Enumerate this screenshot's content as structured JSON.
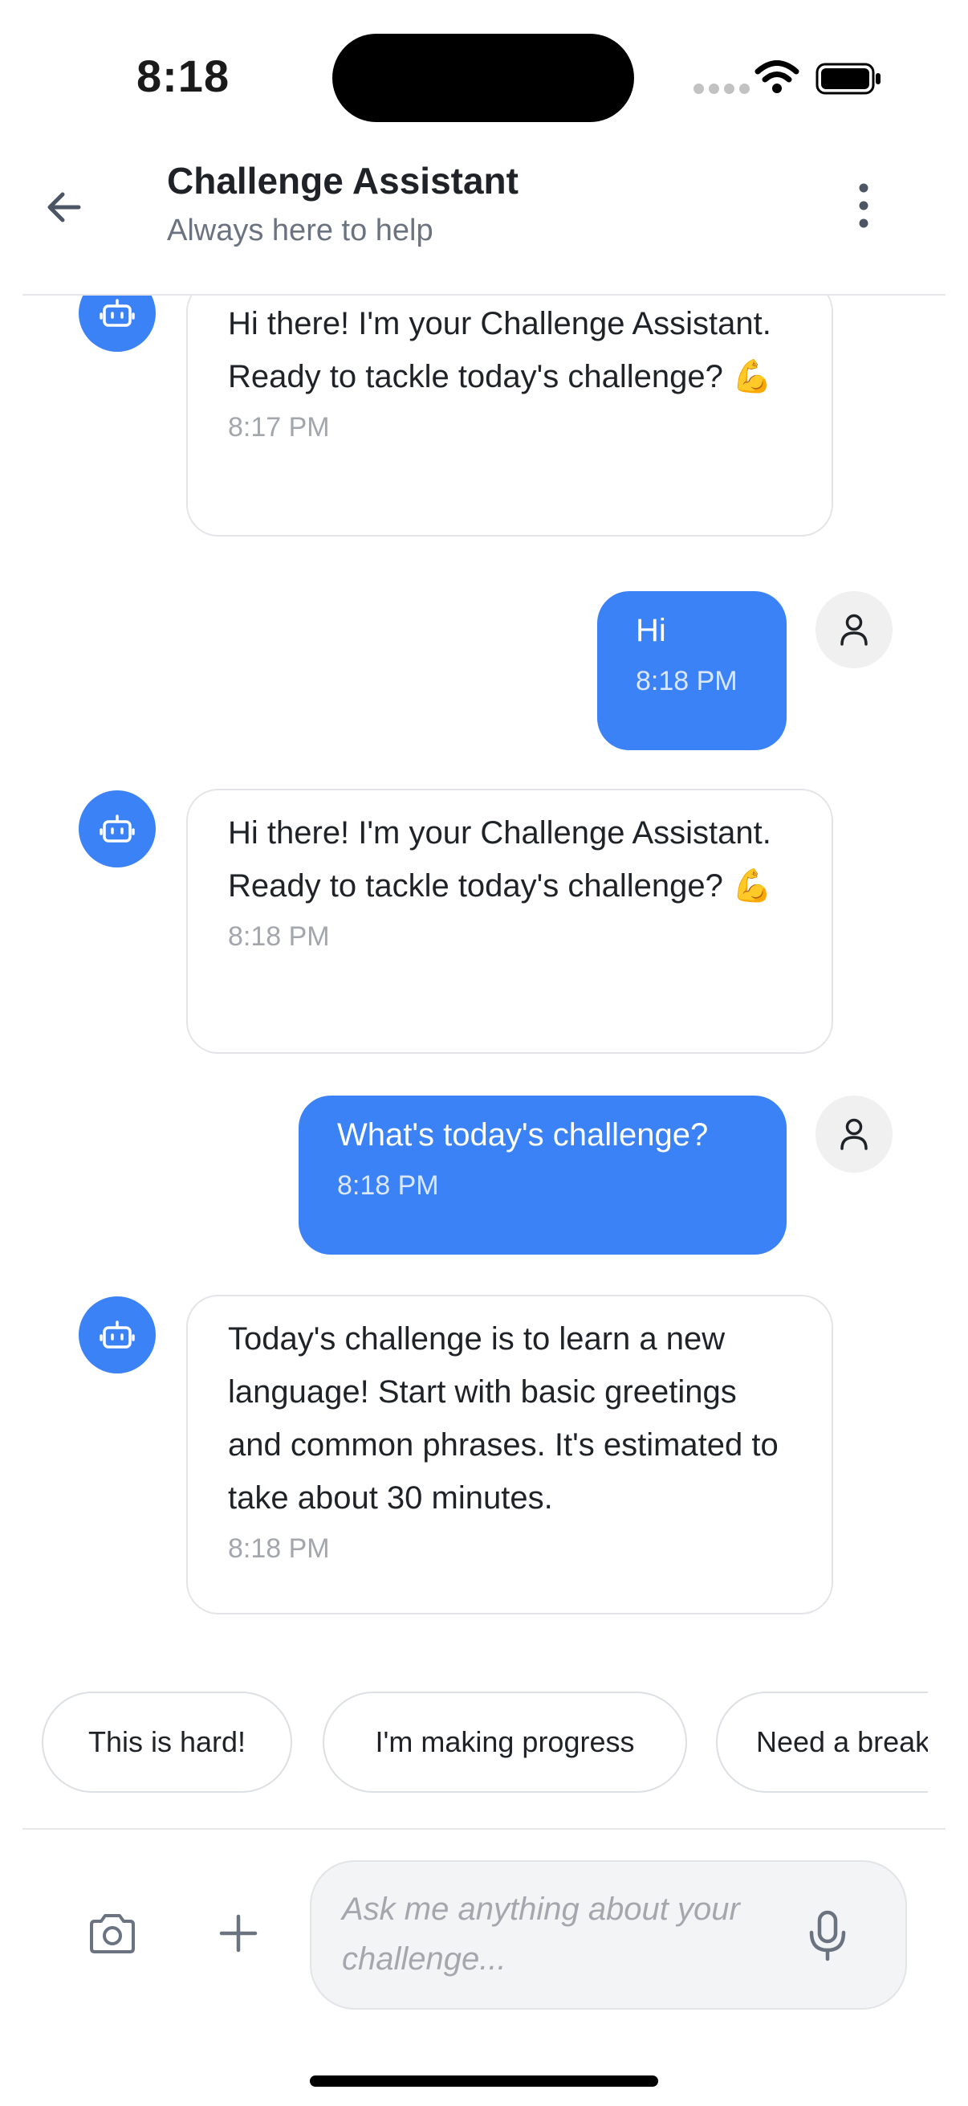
{
  "status_bar": {
    "time": "8:18"
  },
  "header": {
    "title": "Challenge Assistant",
    "subtitle": "Always here to help"
  },
  "messages": [
    {
      "sender": "bot",
      "text": "Hi there! I'm your Challenge Assistant. Ready to tackle today's challenge? 💪",
      "time": "8:17 PM"
    },
    {
      "sender": "user",
      "text": "Hi",
      "time": "8:18 PM"
    },
    {
      "sender": "bot",
      "text": "Hi there! I'm your Challenge Assistant. Ready to tackle today's challenge? 💪",
      "time": "8:18 PM"
    },
    {
      "sender": "user",
      "text": "What's today's challenge?",
      "time": "8:18 PM"
    },
    {
      "sender": "bot",
      "text": "Today's challenge is to learn a new language! Start with basic greetings and common phrases. It's estimated to take about 30 minutes.",
      "time": "8:18 PM"
    }
  ],
  "quick_replies": [
    "This is hard!",
    "I'm making progress",
    "Need a break"
  ],
  "input": {
    "placeholder": "Ask me anything about your challenge..."
  },
  "colors": {
    "accent": "#3b82f6",
    "bot_bubble_border": "#e2e4e8",
    "muted_text": "#6b7280"
  },
  "icons": {
    "back": "arrow-left-icon",
    "more": "more-vertical-icon",
    "bot": "robot-icon",
    "user": "user-icon",
    "camera": "camera-icon",
    "plus": "plus-icon",
    "mic": "microphone-icon"
  }
}
